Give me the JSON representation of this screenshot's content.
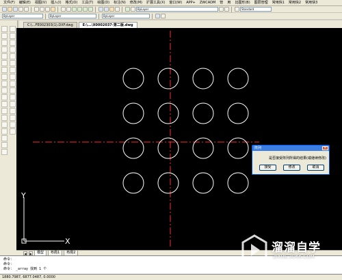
{
  "menu": [
    {
      "label": "文件(F)"
    },
    {
      "label": "编辑(E)"
    },
    {
      "label": "视图(V)"
    },
    {
      "label": "插入(I)"
    },
    {
      "label": "格式(O)"
    },
    {
      "label": "工具(T)"
    },
    {
      "label": "绘图(D)"
    },
    {
      "label": "标注(N)"
    },
    {
      "label": "修改(M)"
    },
    {
      "label": "扩展工具(X)"
    },
    {
      "label": "窗口(W)"
    },
    {
      "label": "APP+"
    },
    {
      "label": "ZWCADM"
    },
    {
      "label": "管"
    },
    {
      "label": "用"
    },
    {
      "label": "比图形(B)"
    },
    {
      "label": "图层管理"
    },
    {
      "label": "常用快1"
    },
    {
      "label": "常用快2"
    },
    {
      "label": "常用快3"
    }
  ],
  "toolbar": {
    "layer_combo": "ByLayer",
    "layer_combo2": "ByLayer",
    "linetype_combo": "ByLayer",
    "lineweight_combo": "ByLayer",
    "standard_combo": "Standard"
  },
  "doc_tabs": [
    {
      "label": "C:\\...FE002303(1).DXF.dwg"
    },
    {
      "label": "E:\\...\\X0002037-第二版.dwg"
    }
  ],
  "layout_tabs": [
    {
      "label": "模型"
    },
    {
      "label": "布局1"
    },
    {
      "label": "布局2"
    }
  ],
  "axes": {
    "x_label": "X",
    "y_label": "Y"
  },
  "dialog": {
    "title": "阵列",
    "close_glyph": "✕",
    "message": "是否接受阵列所得的结果(或继续修改)",
    "buttons": [
      {
        "label": "接受"
      },
      {
        "label": "修改"
      },
      {
        "label": "取消"
      }
    ]
  },
  "command": {
    "lines": [
      "命令：",
      "命令：",
      "命令：  _array 找到 1 个"
    ]
  },
  "status": {
    "coords": "1880.7987, 6877.0487, 0.0000"
  },
  "watermark": {
    "brand": "溜溜自学",
    "url": "ZIXUE.3D66.COM"
  },
  "drawing": {
    "grid_rows": 4,
    "grid_cols": 4,
    "circle_color": "#ffffff",
    "centerline_color": "#ff2a2a",
    "canvas_bg": "#000000"
  }
}
